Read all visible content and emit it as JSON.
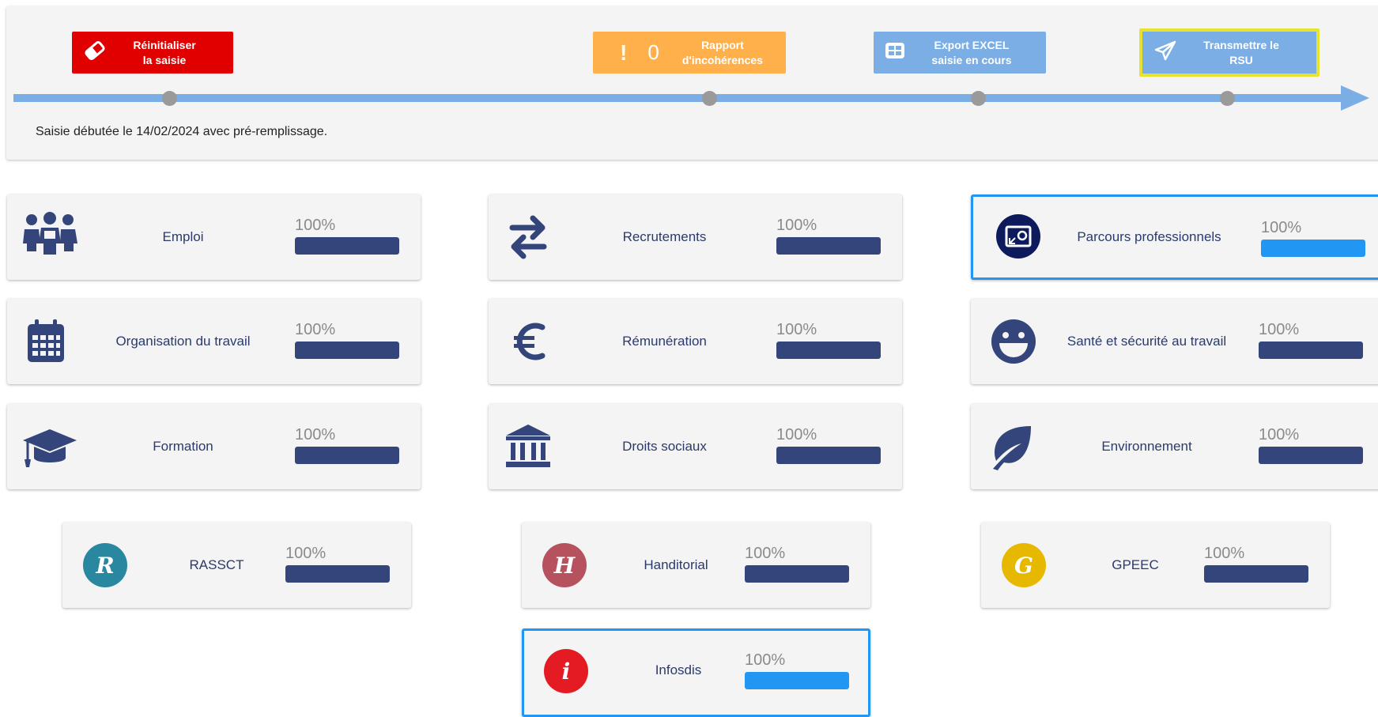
{
  "timeline": {
    "reset_label": "Réinitialiser\nla saisie",
    "report_bang": "!",
    "report_count": "0",
    "report_label": "Rapport\nd'incohérences",
    "export_label": "Export EXCEL\nsaisie en cours",
    "send_label": "Transmettre le\nRSU",
    "start_text": "Saisie débutée le 14/02/2024 avec pré-remplissage."
  },
  "colors": {
    "accent": "#2196f3",
    "bar_fill": "#33457a",
    "reset": "#e00000",
    "report": "#ffb04a",
    "export": "#7aaee5",
    "send_border": "#e6e22d"
  },
  "cards": [
    {
      "title": "Emploi",
      "percent_label": "100%",
      "progress": 1.0,
      "icon": "people-group-icon"
    },
    {
      "title": "Recrutements",
      "percent_label": "100%",
      "progress": 1.0,
      "icon": "exchange-arrows-icon"
    },
    {
      "title": "Parcours professionnels",
      "percent_label": "100%",
      "progress": 1.0,
      "icon": "career-path-icon",
      "active": true
    },
    {
      "title": "Organisation du travail",
      "percent_label": "100%",
      "progress": 1.0,
      "icon": "calendar-icon"
    },
    {
      "title": "Rémunération",
      "percent_label": "100%",
      "progress": 1.0,
      "icon": "euro-icon"
    },
    {
      "title": "Santé et sécurité au travail",
      "percent_label": "100%",
      "progress": 1.0,
      "icon": "smiley-icon"
    },
    {
      "title": "Formation",
      "percent_label": "100%",
      "progress": 1.0,
      "icon": "graduation-cap-icon"
    },
    {
      "title": "Droits sociaux",
      "percent_label": "100%",
      "progress": 1.0,
      "icon": "institution-icon"
    },
    {
      "title": "Environnement",
      "percent_label": "100%",
      "progress": 1.0,
      "icon": "leaf-icon"
    },
    {
      "title": "RASSCT",
      "percent_label": "100%",
      "progress": 1.0,
      "icon": "letter-r-icon",
      "letter": "R"
    },
    {
      "title": "Handitorial",
      "percent_label": "100%",
      "progress": 1.0,
      "icon": "letter-h-icon",
      "letter": "H"
    },
    {
      "title": "GPEEC",
      "percent_label": "100%",
      "progress": 1.0,
      "icon": "letter-g-icon",
      "letter": "G"
    },
    {
      "title": "Infosdis",
      "percent_label": "100%",
      "progress": 1.0,
      "icon": "info-icon",
      "letter": "i",
      "active": true
    }
  ]
}
